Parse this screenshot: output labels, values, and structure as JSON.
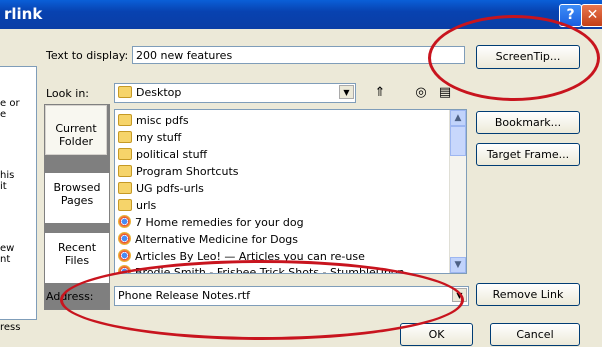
{
  "window": {
    "title": "rlink",
    "help_glyph": "?",
    "close_glyph": "✕"
  },
  "left_pane": {
    "lines": [
      "e or",
      "e",
      "his",
      "it",
      "ew",
      "nt",
      "ress"
    ]
  },
  "places": [
    {
      "line1": "Current",
      "line2": "Folder",
      "selected": true
    },
    {
      "line1": "Browsed",
      "line2": "Pages",
      "selected": false
    },
    {
      "line1": "Recent",
      "line2": "Files",
      "selected": false
    }
  ],
  "text_to_display": {
    "label": "Text to display:",
    "value": "200 new features"
  },
  "look_in": {
    "label": "Look in:",
    "value": "Desktop"
  },
  "files": [
    {
      "name": "misc pdfs",
      "icon": "folder-icon"
    },
    {
      "name": "my stuff",
      "icon": "folder-icon"
    },
    {
      "name": "political stuff",
      "icon": "folder-icon"
    },
    {
      "name": "Program Shortcuts",
      "icon": "folder-icon"
    },
    {
      "name": "UG pdfs-urls",
      "icon": "folder-icon"
    },
    {
      "name": "urls",
      "icon": "folder-icon"
    },
    {
      "name": "7 Home remedies for your dog",
      "icon": "chrome-shortcut-icon"
    },
    {
      "name": "Alternative Medicine for Dogs",
      "icon": "chrome-shortcut-icon"
    },
    {
      "name": "Articles By Leo! — Articles you can re-use",
      "icon": "chrome-shortcut-icon"
    },
    {
      "name": "Brodie Smith - Frisbee Trick Shots - StumbleUpon",
      "icon": "chrome-shortcut-icon"
    }
  ],
  "address": {
    "label": "Address:",
    "value": "Phone Release Notes.rtf"
  },
  "buttons": {
    "screentip": "ScreenTip...",
    "bookmark": "Bookmark...",
    "target_frame": "Target Frame...",
    "remove_link": "Remove Link",
    "ok": "OK",
    "cancel": "Cancel"
  },
  "annotation_color": "#c8141e"
}
